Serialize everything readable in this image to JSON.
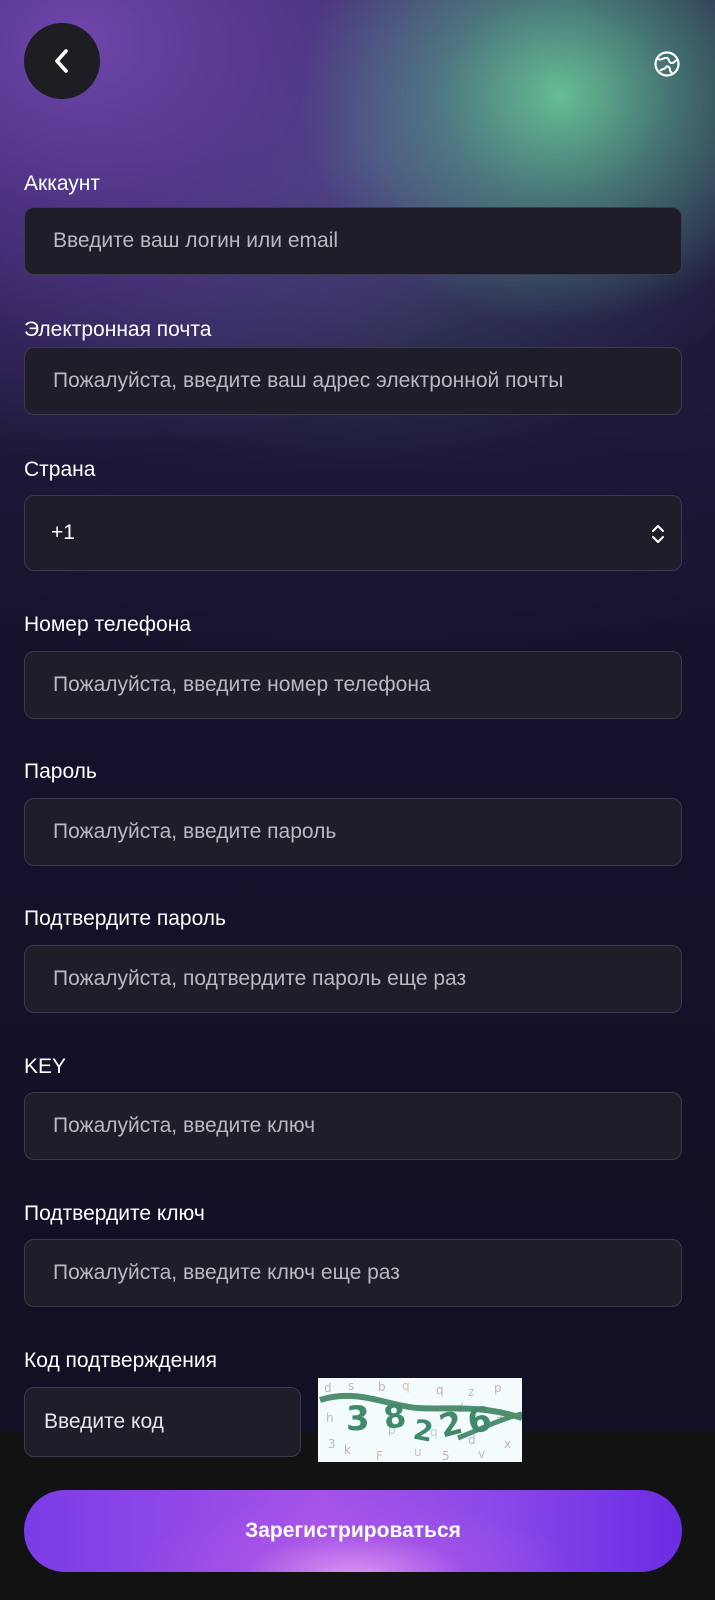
{
  "header": {
    "back_icon": "chevron-left-icon",
    "language_icon": "globe-icon"
  },
  "fields": {
    "account": {
      "label": "Аккаунт",
      "placeholder": "Введите ваш логин или email"
    },
    "email": {
      "label": "Электронная почта",
      "placeholder": "Пожалуйста, введите ваш адрес электронной почты"
    },
    "country": {
      "label": "Страна",
      "value": "+1"
    },
    "phone": {
      "label": "Номер телефона",
      "placeholder": "Пожалуйста, введите номер телефона"
    },
    "password": {
      "label": "Пароль",
      "placeholder": "Пожалуйста, введите пароль"
    },
    "password_confirm": {
      "label": "Подтвердите пароль",
      "placeholder": "Пожалуйста, подтвердите пароль еще раз"
    },
    "key": {
      "label": "KEY",
      "placeholder": "Пожалуйста, введите ключ"
    },
    "key_confirm": {
      "label": "Подтвердите ключ",
      "placeholder": "Пожалуйста, введите ключ еще раз"
    },
    "captcha": {
      "label": "Код подтверждения",
      "placeholder": "Введите код",
      "image_text": "38226"
    }
  },
  "submit_label": "Зарегистрироваться",
  "colors": {
    "background": "#100f22",
    "field_bg": "#1e1d29",
    "field_border": "#3a3a4c",
    "button_accent": "#8c4ae8",
    "captcha_green": "#3f8a6a"
  }
}
